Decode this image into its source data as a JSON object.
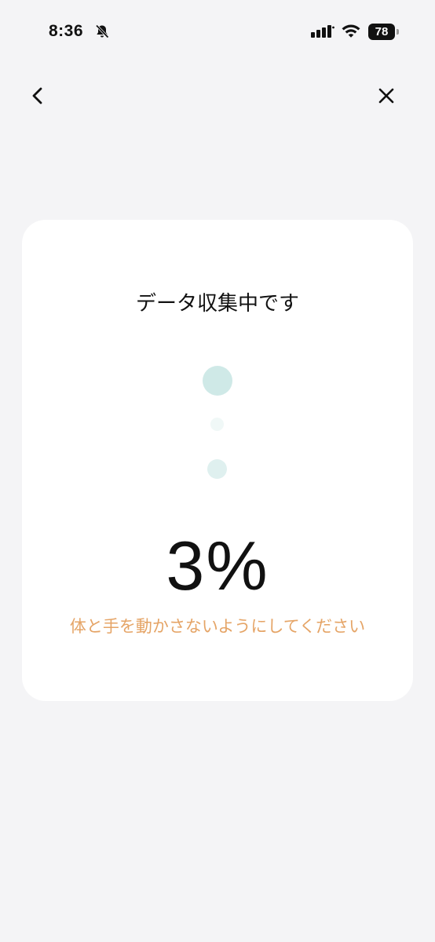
{
  "status_bar": {
    "time": "8:36",
    "battery": "78",
    "icons": [
      "bell-off-icon",
      "signal-icon",
      "wifi-icon",
      "battery-icon"
    ]
  },
  "nav": {
    "back_icon": "chevron-left-icon",
    "close_icon": "close-icon"
  },
  "card": {
    "title": "データ収集中です",
    "progress_label": "3%",
    "progress_percent": 3,
    "instruction": "体と手を動かさないようにしてください"
  },
  "colors": {
    "background": "#f4f4f6",
    "card": "#ffffff",
    "accent_orange": "#e5a466",
    "dot_teal": "#cfe9e7"
  }
}
